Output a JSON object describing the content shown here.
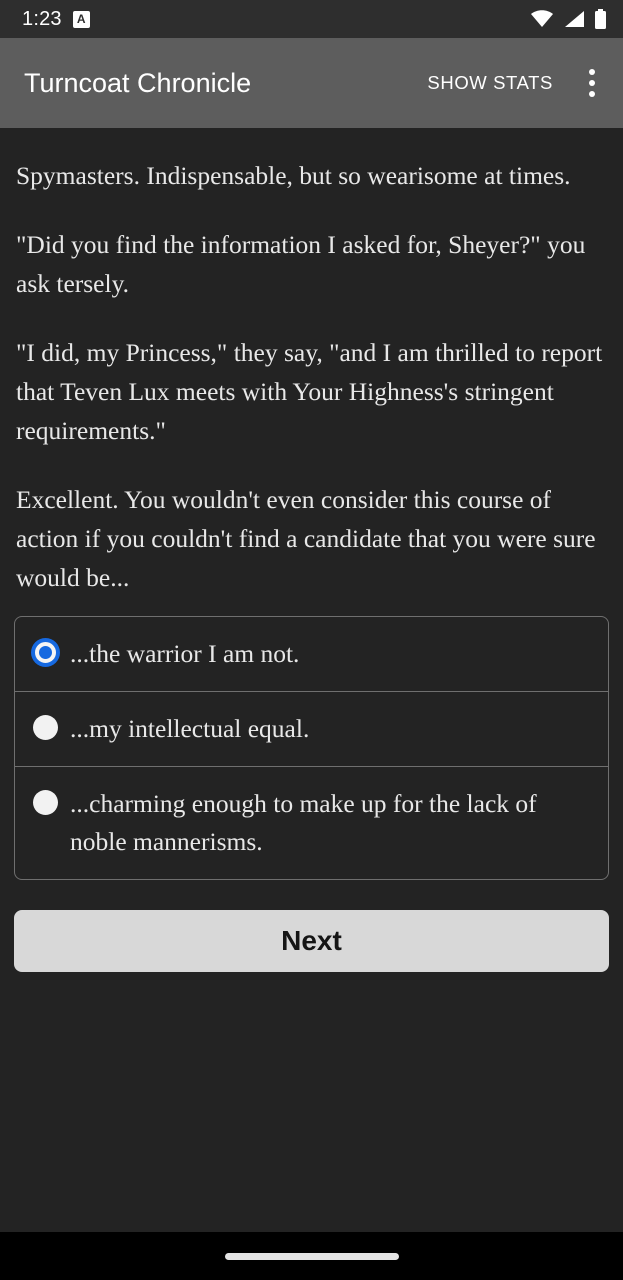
{
  "status_bar": {
    "clock": "1:23",
    "notification_icon_label": "A",
    "icons": [
      "wifi-icon",
      "cell-signal-icon",
      "battery-icon"
    ]
  },
  "app_bar": {
    "title": "Turncoat Chronicle",
    "show_stats_label": "SHOW STATS",
    "overflow_menu_icon": "more-vert-icon",
    "background_color": "#5d5d5d"
  },
  "story": {
    "paragraphs": [
      "Spymasters. Indispensable, but so wearisome at times.",
      "\"Did you find the information I asked for, Sheyer?\" you ask tersely.",
      "\"I did, my Princess,\" they say, \"and I am thrilled to report that Teven Lux meets with Your Highness's stringent requirements.\"",
      "Excellent. You wouldn't even consider this course of action if you couldn't find a candidate that you were sure would be..."
    ]
  },
  "choices": {
    "selected_index": 0,
    "accent_color": "#1669e0",
    "options": [
      {
        "label": "...the warrior I am not.",
        "selected": true
      },
      {
        "label": "...my intellectual equal.",
        "selected": false
      },
      {
        "label": "...charming enough to make up for the lack of noble mannerisms.",
        "selected": false
      }
    ]
  },
  "next_button": {
    "label": "Next",
    "background_color": "#d8d8d8"
  },
  "nav_bar": {
    "gesture_pill": "home-gesture-pill"
  },
  "theme": {
    "page_background": "#232323",
    "status_bar_background": "#2e2e2e",
    "text_color": "#e8e8e8",
    "border_color": "#6f6f6f"
  }
}
